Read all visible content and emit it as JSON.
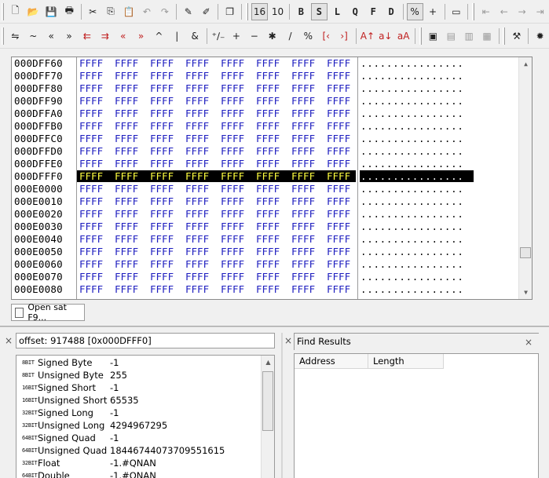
{
  "toolbar_top": {
    "items": [
      {
        "type": "grip"
      },
      {
        "type": "btn",
        "icon": "new-file-icon",
        "glyph": "🗋"
      },
      {
        "type": "btn",
        "icon": "open-folder-icon",
        "glyph": "📂"
      },
      {
        "type": "btn",
        "icon": "save-icon",
        "glyph": "💾"
      },
      {
        "type": "btn",
        "icon": "print-icon",
        "glyph": "🖶"
      },
      {
        "type": "sep"
      },
      {
        "type": "btn",
        "icon": "cut-icon",
        "glyph": "✂"
      },
      {
        "type": "btn",
        "icon": "copy-icon",
        "glyph": "⎘"
      },
      {
        "type": "btn",
        "icon": "paste-icon",
        "glyph": "📋",
        "style": "grey"
      },
      {
        "type": "btn",
        "icon": "undo-icon",
        "glyph": "↶",
        "style": "grey"
      },
      {
        "type": "btn",
        "icon": "redo-icon",
        "glyph": "↷",
        "style": "grey"
      },
      {
        "type": "sep"
      },
      {
        "type": "btn",
        "icon": "mark-icon",
        "glyph": "✎"
      },
      {
        "type": "btn",
        "icon": "clear-mark-icon",
        "glyph": "✐"
      },
      {
        "type": "sep"
      },
      {
        "type": "btn",
        "icon": "compare-icon",
        "glyph": "❐"
      },
      {
        "type": "sep"
      },
      {
        "type": "grip"
      },
      {
        "type": "btn",
        "icon": "hex-16-icon",
        "glyph": "16",
        "style": "pressed"
      },
      {
        "type": "btn",
        "icon": "dec-10-icon",
        "glyph": "10"
      },
      {
        "type": "sep"
      },
      {
        "type": "btn",
        "icon": "byte-mode-icon",
        "glyph": "B",
        "style": "bold"
      },
      {
        "type": "btn",
        "icon": "short-mode-icon",
        "glyph": "S",
        "style": "bold pressed"
      },
      {
        "type": "btn",
        "icon": "long-mode-icon",
        "glyph": "L",
        "style": "bold"
      },
      {
        "type": "btn",
        "icon": "quad-mode-icon",
        "glyph": "Q",
        "style": "bold"
      },
      {
        "type": "btn",
        "icon": "float-mode-icon",
        "glyph": "F",
        "style": "bold"
      },
      {
        "type": "btn",
        "icon": "double-mode-icon",
        "glyph": "D",
        "style": "bold"
      },
      {
        "type": "sep"
      },
      {
        "type": "btn",
        "icon": "percent-toggle-icon",
        "glyph": "%",
        "style": "pressed"
      },
      {
        "type": "btn",
        "icon": "plus-toggle-icon",
        "glyph": "+"
      },
      {
        "type": "sep"
      },
      {
        "type": "btn",
        "icon": "panel-view-icon",
        "glyph": "▭"
      },
      {
        "type": "sep"
      },
      {
        "type": "grip"
      },
      {
        "type": "btn",
        "icon": "go-start-icon",
        "glyph": "⇤",
        "style": "grey"
      },
      {
        "type": "btn",
        "icon": "back-icon",
        "glyph": "←",
        "style": "grey"
      },
      {
        "type": "btn",
        "icon": "forward-icon",
        "glyph": "→",
        "style": "grey"
      },
      {
        "type": "btn",
        "icon": "go-end-icon",
        "glyph": "⇥",
        "style": "grey"
      }
    ]
  },
  "toolbar_ops": {
    "items": [
      {
        "type": "grip"
      },
      {
        "type": "btn",
        "icon": "swap-icon",
        "glyph": "⇋"
      },
      {
        "type": "btn",
        "icon": "tilde-icon",
        "glyph": "~"
      },
      {
        "type": "btn",
        "icon": "shift-left-icon",
        "glyph": "«"
      },
      {
        "type": "btn",
        "icon": "shift-right-icon",
        "glyph": "»"
      },
      {
        "type": "btn",
        "icon": "rotate-left-icon",
        "glyph": "⇇",
        "style": "red"
      },
      {
        "type": "btn",
        "icon": "rotate-right-icon",
        "glyph": "⇉",
        "style": "red"
      },
      {
        "type": "btn",
        "icon": "rotate-left-carry-icon",
        "glyph": "«",
        "style": "red"
      },
      {
        "type": "btn",
        "icon": "rotate-right-carry-icon",
        "glyph": "»",
        "style": "red"
      },
      {
        "type": "btn",
        "icon": "xor-icon",
        "glyph": "^"
      },
      {
        "type": "btn",
        "icon": "or-icon",
        "glyph": "|"
      },
      {
        "type": "btn",
        "icon": "and-icon",
        "glyph": "&"
      },
      {
        "type": "sep"
      },
      {
        "type": "btn",
        "icon": "negate-icon",
        "glyph": "⁺∕₋"
      },
      {
        "type": "btn",
        "icon": "add-icon",
        "glyph": "+"
      },
      {
        "type": "btn",
        "icon": "subtract-icon",
        "glyph": "−"
      },
      {
        "type": "btn",
        "icon": "multiply-icon",
        "glyph": "✱"
      },
      {
        "type": "btn",
        "icon": "divide-icon",
        "glyph": "/"
      },
      {
        "type": "btn",
        "icon": "modulo-icon",
        "glyph": "%"
      },
      {
        "type": "btn",
        "icon": "min-icon",
        "glyph": "[‹",
        "style": "red"
      },
      {
        "type": "btn",
        "icon": "max-icon",
        "glyph": "›]",
        "style": "red"
      },
      {
        "type": "sep"
      },
      {
        "type": "btn",
        "icon": "uppercase-icon",
        "glyph": "A↑",
        "style": "red"
      },
      {
        "type": "btn",
        "icon": "lowercase-icon",
        "glyph": "a↓",
        "style": "red"
      },
      {
        "type": "btn",
        "icon": "toggle-case-icon",
        "glyph": "aA",
        "style": "red"
      },
      {
        "type": "sep"
      },
      {
        "type": "grip"
      },
      {
        "type": "btn",
        "icon": "layout-1-icon",
        "glyph": "▣"
      },
      {
        "type": "btn",
        "icon": "layout-2-icon",
        "glyph": "▤",
        "style": "grey"
      },
      {
        "type": "btn",
        "icon": "layout-3-icon",
        "glyph": "▥",
        "style": "grey"
      },
      {
        "type": "btn",
        "icon": "layout-4-icon",
        "glyph": "▦",
        "style": "grey"
      },
      {
        "type": "sep"
      },
      {
        "type": "grip"
      },
      {
        "type": "btn",
        "icon": "tools-icon",
        "glyph": "⚒"
      },
      {
        "type": "sep"
      },
      {
        "type": "btn",
        "icon": "settings-icon",
        "glyph": "✹"
      }
    ]
  },
  "hex_view": {
    "selected_offset": "000DFFF0",
    "rows": [
      {
        "offset": "000DFF60",
        "cells": [
          "FFFF",
          "FFFF",
          "FFFF",
          "FFFF",
          "FFFF",
          "FFFF",
          "FFFF",
          "FFFF"
        ],
        "ascii": "................"
      },
      {
        "offset": "000DFF70",
        "cells": [
          "FFFF",
          "FFFF",
          "FFFF",
          "FFFF",
          "FFFF",
          "FFFF",
          "FFFF",
          "FFFF"
        ],
        "ascii": "................"
      },
      {
        "offset": "000DFF80",
        "cells": [
          "FFFF",
          "FFFF",
          "FFFF",
          "FFFF",
          "FFFF",
          "FFFF",
          "FFFF",
          "FFFF"
        ],
        "ascii": "................"
      },
      {
        "offset": "000DFF90",
        "cells": [
          "FFFF",
          "FFFF",
          "FFFF",
          "FFFF",
          "FFFF",
          "FFFF",
          "FFFF",
          "FFFF"
        ],
        "ascii": "................"
      },
      {
        "offset": "000DFFA0",
        "cells": [
          "FFFF",
          "FFFF",
          "FFFF",
          "FFFF",
          "FFFF",
          "FFFF",
          "FFFF",
          "FFFF"
        ],
        "ascii": "................"
      },
      {
        "offset": "000DFFB0",
        "cells": [
          "FFFF",
          "FFFF",
          "FFFF",
          "FFFF",
          "FFFF",
          "FFFF",
          "FFFF",
          "FFFF"
        ],
        "ascii": "................"
      },
      {
        "offset": "000DFFC0",
        "cells": [
          "FFFF",
          "FFFF",
          "FFFF",
          "FFFF",
          "FFFF",
          "FFFF",
          "FFFF",
          "FFFF"
        ],
        "ascii": "................"
      },
      {
        "offset": "000DFFD0",
        "cells": [
          "FFFF",
          "FFFF",
          "FFFF",
          "FFFF",
          "FFFF",
          "FFFF",
          "FFFF",
          "FFFF"
        ],
        "ascii": "................"
      },
      {
        "offset": "000DFFE0",
        "cells": [
          "FFFF",
          "FFFF",
          "FFFF",
          "FFFF",
          "FFFF",
          "FFFF",
          "FFFF",
          "FFFF"
        ],
        "ascii": "................"
      },
      {
        "offset": "000DFFF0",
        "cells": [
          "FFFF",
          "FFFF",
          "FFFF",
          "FFFF",
          "FFFF",
          "FFFF",
          "FFFF",
          "FFFF"
        ],
        "ascii": "................",
        "selected": true
      },
      {
        "offset": "000E0000",
        "cells": [
          "FFFF",
          "FFFF",
          "FFFF",
          "FFFF",
          "FFFF",
          "FFFF",
          "FFFF",
          "FFFF"
        ],
        "ascii": "................"
      },
      {
        "offset": "000E0010",
        "cells": [
          "FFFF",
          "FFFF",
          "FFFF",
          "FFFF",
          "FFFF",
          "FFFF",
          "FFFF",
          "FFFF"
        ],
        "ascii": "................"
      },
      {
        "offset": "000E0020",
        "cells": [
          "FFFF",
          "FFFF",
          "FFFF",
          "FFFF",
          "FFFF",
          "FFFF",
          "FFFF",
          "FFFF"
        ],
        "ascii": "................"
      },
      {
        "offset": "000E0030",
        "cells": [
          "FFFF",
          "FFFF",
          "FFFF",
          "FFFF",
          "FFFF",
          "FFFF",
          "FFFF",
          "FFFF"
        ],
        "ascii": "................"
      },
      {
        "offset": "000E0040",
        "cells": [
          "FFFF",
          "FFFF",
          "FFFF",
          "FFFF",
          "FFFF",
          "FFFF",
          "FFFF",
          "FFFF"
        ],
        "ascii": "................"
      },
      {
        "offset": "000E0050",
        "cells": [
          "FFFF",
          "FFFF",
          "FFFF",
          "FFFF",
          "FFFF",
          "FFFF",
          "FFFF",
          "FFFF"
        ],
        "ascii": "................"
      },
      {
        "offset": "000E0060",
        "cells": [
          "FFFF",
          "FFFF",
          "FFFF",
          "FFFF",
          "FFFF",
          "FFFF",
          "FFFF",
          "FFFF"
        ],
        "ascii": "................"
      },
      {
        "offset": "000E0070",
        "cells": [
          "FFFF",
          "FFFF",
          "FFFF",
          "FFFF",
          "FFFF",
          "FFFF",
          "FFFF",
          "FFFF"
        ],
        "ascii": "................"
      },
      {
        "offset": "000E0080",
        "cells": [
          "FFFF",
          "FFFF",
          "FFFF",
          "FFFF",
          "FFFF",
          "FFFF",
          "FFFF",
          "FFFF"
        ],
        "ascii": "................"
      }
    ]
  },
  "tabs": [
    {
      "label": "Open sat F9..."
    }
  ],
  "data_inspector": {
    "offset_text": "offset: 917488 [0x000DFFF0]",
    "close_glyph": "×",
    "rows": [
      {
        "bits": "8BIT",
        "label": "Signed Byte",
        "value": "-1"
      },
      {
        "bits": "8BIT",
        "label": "Unsigned Byte",
        "value": "255"
      },
      {
        "bits": "16BIT",
        "label": "Signed Short",
        "value": "-1"
      },
      {
        "bits": "16BIT",
        "label": "Unsigned Short",
        "value": "65535"
      },
      {
        "bits": "32BIT",
        "label": "Signed Long",
        "value": "-1"
      },
      {
        "bits": "32BIT",
        "label": "Unsigned Long",
        "value": "4294967295"
      },
      {
        "bits": "64BIT",
        "label": "Signed Quad",
        "value": "-1"
      },
      {
        "bits": "64BIT",
        "label": "Unsigned Quad",
        "value": "18446744073709551615"
      },
      {
        "bits": "32BIT",
        "label": "Float",
        "value": "-1.#QNAN"
      },
      {
        "bits": "64BIT",
        "label": "Double",
        "value": "-1.#QNAN"
      }
    ]
  },
  "find_results": {
    "title": "Find Results",
    "close_glyph": "×",
    "columns": [
      "Address",
      "Length"
    ]
  },
  "colors": {
    "hex_text": "#1d1dbf",
    "selected_hex_text": "#ffff40",
    "selection_background": "#000000"
  }
}
